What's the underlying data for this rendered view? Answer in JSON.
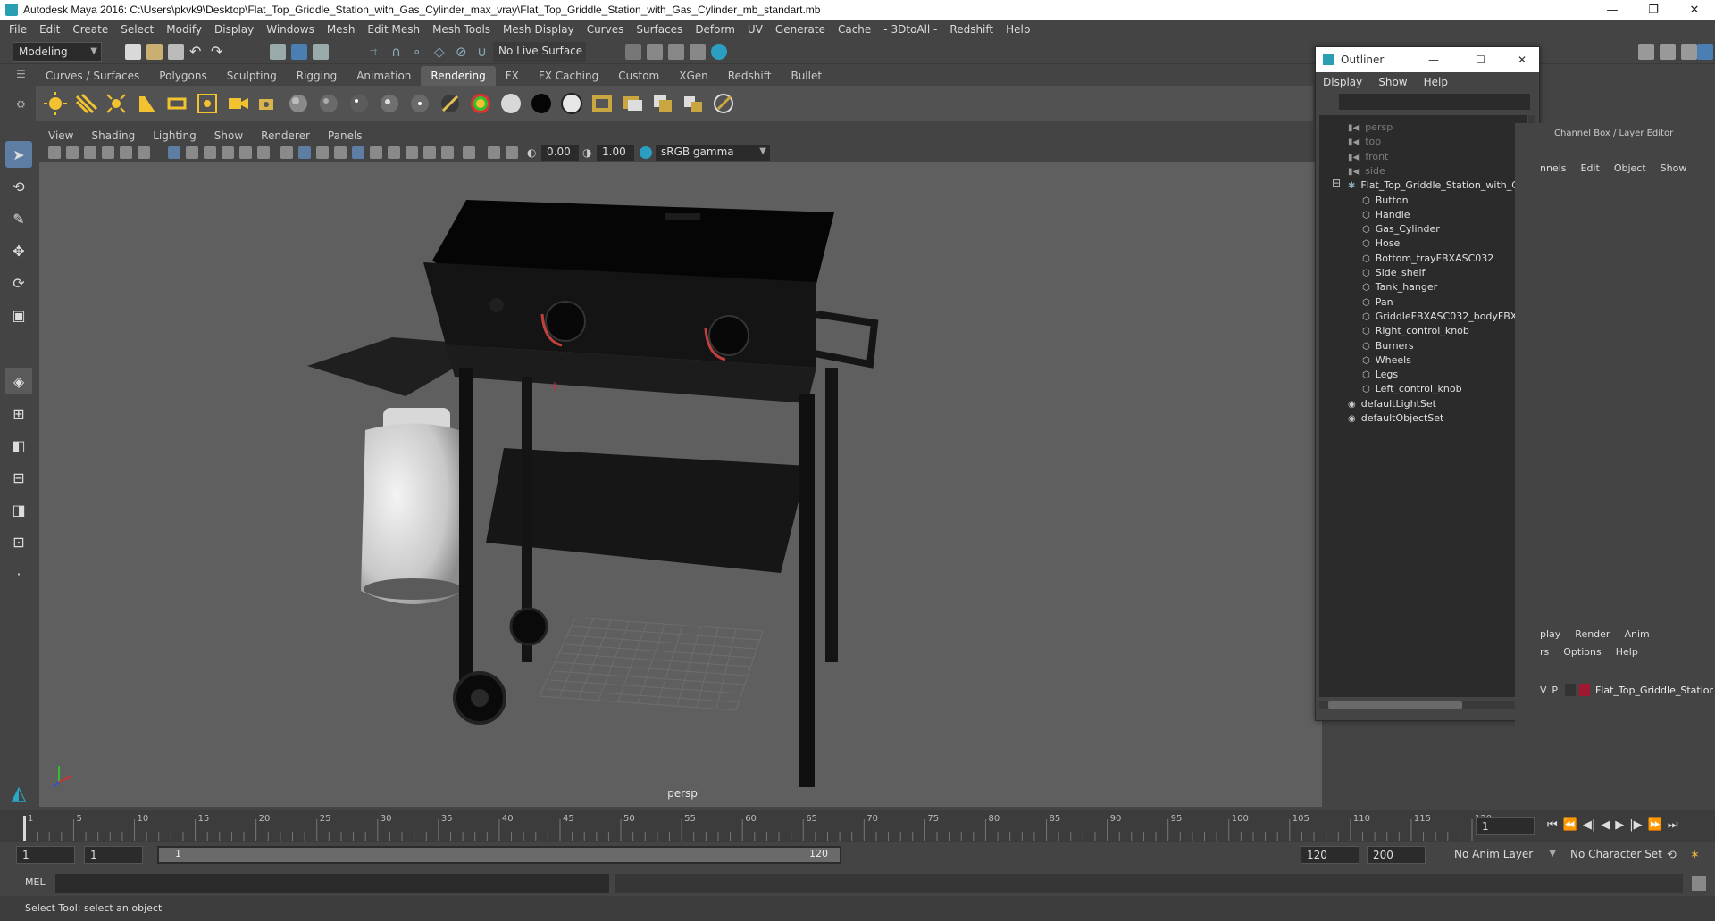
{
  "window": {
    "title": "Autodesk Maya 2016: C:\\Users\\pkvk9\\Desktop\\Flat_Top_Griddle_Station_with_Gas_Cylinder_max_vray\\Flat_Top_Griddle_Station_with_Gas_Cylinder_mb_standart.mb",
    "minimize": "—",
    "maximize": "❐",
    "close": "✕"
  },
  "menubar": [
    "File",
    "Edit",
    "Create",
    "Select",
    "Modify",
    "Display",
    "Windows",
    "Mesh",
    "Edit Mesh",
    "Mesh Tools",
    "Mesh Display",
    "Curves",
    "Surfaces",
    "Deform",
    "UV",
    "Generate",
    "Cache",
    "- 3DtoAll -",
    "Redshift",
    "Help"
  ],
  "statusline": {
    "mode": "Modeling",
    "live_surface": "No Live Surface"
  },
  "shelf_tabs": [
    "Curves / Surfaces",
    "Polygons",
    "Sculpting",
    "Rigging",
    "Animation",
    "Rendering",
    "FX",
    "FX Caching",
    "Custom",
    "XGen",
    "Redshift",
    "Bullet"
  ],
  "shelf_active": "Rendering",
  "viewport": {
    "menus": [
      "View",
      "Shading",
      "Lighting",
      "Show",
      "Renderer",
      "Panels"
    ],
    "exposure": "0.00",
    "gamma": "1.00",
    "color_space": "sRGB gamma",
    "camera_label": "persp"
  },
  "outliner": {
    "title": "Outliner",
    "menus": [
      "Display",
      "Show",
      "Help"
    ],
    "items": [
      {
        "label": "persp",
        "type": "camera",
        "dim": true
      },
      {
        "label": "top",
        "type": "camera",
        "dim": true
      },
      {
        "label": "front",
        "type": "camera",
        "dim": true
      },
      {
        "label": "side",
        "type": "camera",
        "dim": true
      },
      {
        "label": "Flat_Top_Griddle_Station_with_G",
        "type": "group",
        "dim": false
      },
      {
        "label": "Button",
        "type": "mesh",
        "dim": false
      },
      {
        "label": "Handle",
        "type": "mesh",
        "dim": false
      },
      {
        "label": "Gas_Cylinder",
        "type": "mesh",
        "dim": false
      },
      {
        "label": "Hose",
        "type": "mesh",
        "dim": false
      },
      {
        "label": "Bottom_trayFBXASC032",
        "type": "mesh",
        "dim": false
      },
      {
        "label": "Side_shelf",
        "type": "mesh",
        "dim": false
      },
      {
        "label": "Tank_hanger",
        "type": "mesh",
        "dim": false
      },
      {
        "label": "Pan",
        "type": "mesh",
        "dim": false
      },
      {
        "label": "GriddleFBXASC032_bodyFBXA",
        "type": "mesh",
        "dim": false
      },
      {
        "label": "Right_control_knob",
        "type": "mesh",
        "dim": false
      },
      {
        "label": "Burners",
        "type": "mesh",
        "dim": false
      },
      {
        "label": "Wheels",
        "type": "mesh",
        "dim": false
      },
      {
        "label": "Legs",
        "type": "mesh",
        "dim": false
      },
      {
        "label": "Left_control_knob",
        "type": "mesh",
        "dim": false
      },
      {
        "label": "defaultLightSet",
        "type": "set",
        "dim": false
      },
      {
        "label": "defaultObjectSet",
        "type": "set",
        "dim": false
      }
    ]
  },
  "channel_box": {
    "title": "Channel Box / Layer Editor",
    "menus": [
      "nnels",
      "Edit",
      "Object",
      "Show"
    ],
    "layer_tabs": [
      "play",
      "Render",
      "Anim"
    ],
    "layer_menus": [
      "rs",
      "Options",
      "Help"
    ],
    "layer_visibility": "V",
    "layer_playback": "P",
    "layer_name": "Flat_Top_Griddle_Statior",
    "layer_color": "#a01830"
  },
  "timeline": {
    "ticks": [
      "1",
      "5",
      "10",
      "15",
      "20",
      "25",
      "30",
      "35",
      "40",
      "45",
      "50",
      "55",
      "60",
      "65",
      "70",
      "75",
      "80",
      "85",
      "90",
      "95",
      "100",
      "105",
      "110",
      "115",
      "120"
    ],
    "current_frame": "1"
  },
  "range": {
    "start": "1",
    "playback_start": "1",
    "slider_start": "1",
    "slider_end": "120",
    "playback_end": "120",
    "end": "200",
    "anim_layer": "No Anim Layer",
    "character_set": "No Character Set"
  },
  "cmdline": {
    "language": "MEL"
  },
  "helpline": {
    "text": "Select Tool: select an object"
  }
}
